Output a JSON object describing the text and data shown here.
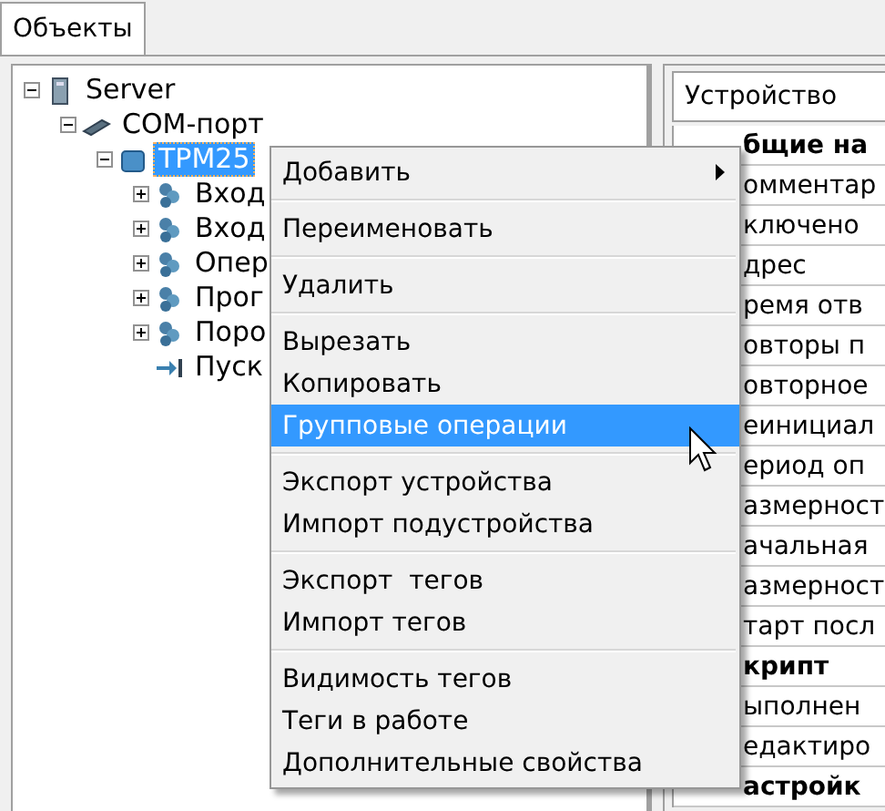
{
  "tabs": [
    {
      "label": "Объекты",
      "selected": true
    }
  ],
  "tree": [
    {
      "label": "Server",
      "kind": "server",
      "expanded": true,
      "selected": false,
      "children": [
        {
          "label": "COM-порт",
          "kind": "port",
          "expanded": true,
          "selected": false,
          "children": [
            {
              "label": "TPM25",
              "kind": "device",
              "expanded": true,
              "selected": true,
              "children": [
                {
                  "label": "Вход",
                  "kind": "group",
                  "expanded": false,
                  "selected": false
                },
                {
                  "label": "Вход",
                  "kind": "group",
                  "expanded": false,
                  "selected": false
                },
                {
                  "label": "Опер",
                  "kind": "group",
                  "expanded": false,
                  "selected": false
                },
                {
                  "label": "Прог",
                  "kind": "group",
                  "expanded": false,
                  "selected": false
                },
                {
                  "label": "Поро",
                  "kind": "group",
                  "expanded": false,
                  "selected": false
                },
                {
                  "label": "Пуск",
                  "kind": "action",
                  "selected": false
                }
              ]
            }
          ]
        }
      ]
    }
  ],
  "properties": {
    "title": "Устройство",
    "rows": [
      {
        "label": "бщие на",
        "kind": "group"
      },
      {
        "label": "омментар",
        "kind": "item"
      },
      {
        "label": "ключено",
        "kind": "item"
      },
      {
        "label": "дрес",
        "kind": "item"
      },
      {
        "label": "ремя отв",
        "kind": "item"
      },
      {
        "label": "овторы п",
        "kind": "item"
      },
      {
        "label": "овторное",
        "kind": "item"
      },
      {
        "label": "еинициал",
        "kind": "item"
      },
      {
        "label": "ериод оп",
        "kind": "item"
      },
      {
        "label": "азмерност",
        "kind": "item"
      },
      {
        "label": "ачальная",
        "kind": "item"
      },
      {
        "label": "азмерност",
        "kind": "item"
      },
      {
        "label": "тарт посл",
        "kind": "item"
      },
      {
        "label": "крипт",
        "kind": "group"
      },
      {
        "label": "ыполнен",
        "kind": "item"
      },
      {
        "label": "едактиро",
        "kind": "item"
      },
      {
        "label": "астройк",
        "kind": "group"
      }
    ]
  },
  "context_menu": [
    {
      "label": "Добавить",
      "kind": "submenu",
      "selected": false
    },
    {
      "kind": "separator"
    },
    {
      "label": "Переименовать",
      "kind": "item",
      "selected": false
    },
    {
      "kind": "separator"
    },
    {
      "label": "Удалить",
      "kind": "item",
      "selected": false
    },
    {
      "kind": "separator"
    },
    {
      "label": "Вырезать",
      "kind": "item",
      "selected": false
    },
    {
      "label": "Копировать",
      "kind": "item",
      "selected": false
    },
    {
      "label": "Групповые операции",
      "kind": "item",
      "selected": true
    },
    {
      "kind": "separator"
    },
    {
      "label": "Экспорт устройства",
      "kind": "item",
      "selected": false
    },
    {
      "label": "Импорт подустройства",
      "kind": "item",
      "selected": false
    },
    {
      "kind": "separator"
    },
    {
      "label": "Экспорт  тегов",
      "kind": "item",
      "selected": false
    },
    {
      "label": "Импорт тегов",
      "kind": "item",
      "selected": false
    },
    {
      "kind": "separator"
    },
    {
      "label": "Видимость тегов",
      "kind": "item",
      "selected": false
    },
    {
      "label": "Теги в работе",
      "kind": "item",
      "selected": false
    },
    {
      "label": "Дополнительные свойства",
      "kind": "item",
      "selected": false
    }
  ]
}
